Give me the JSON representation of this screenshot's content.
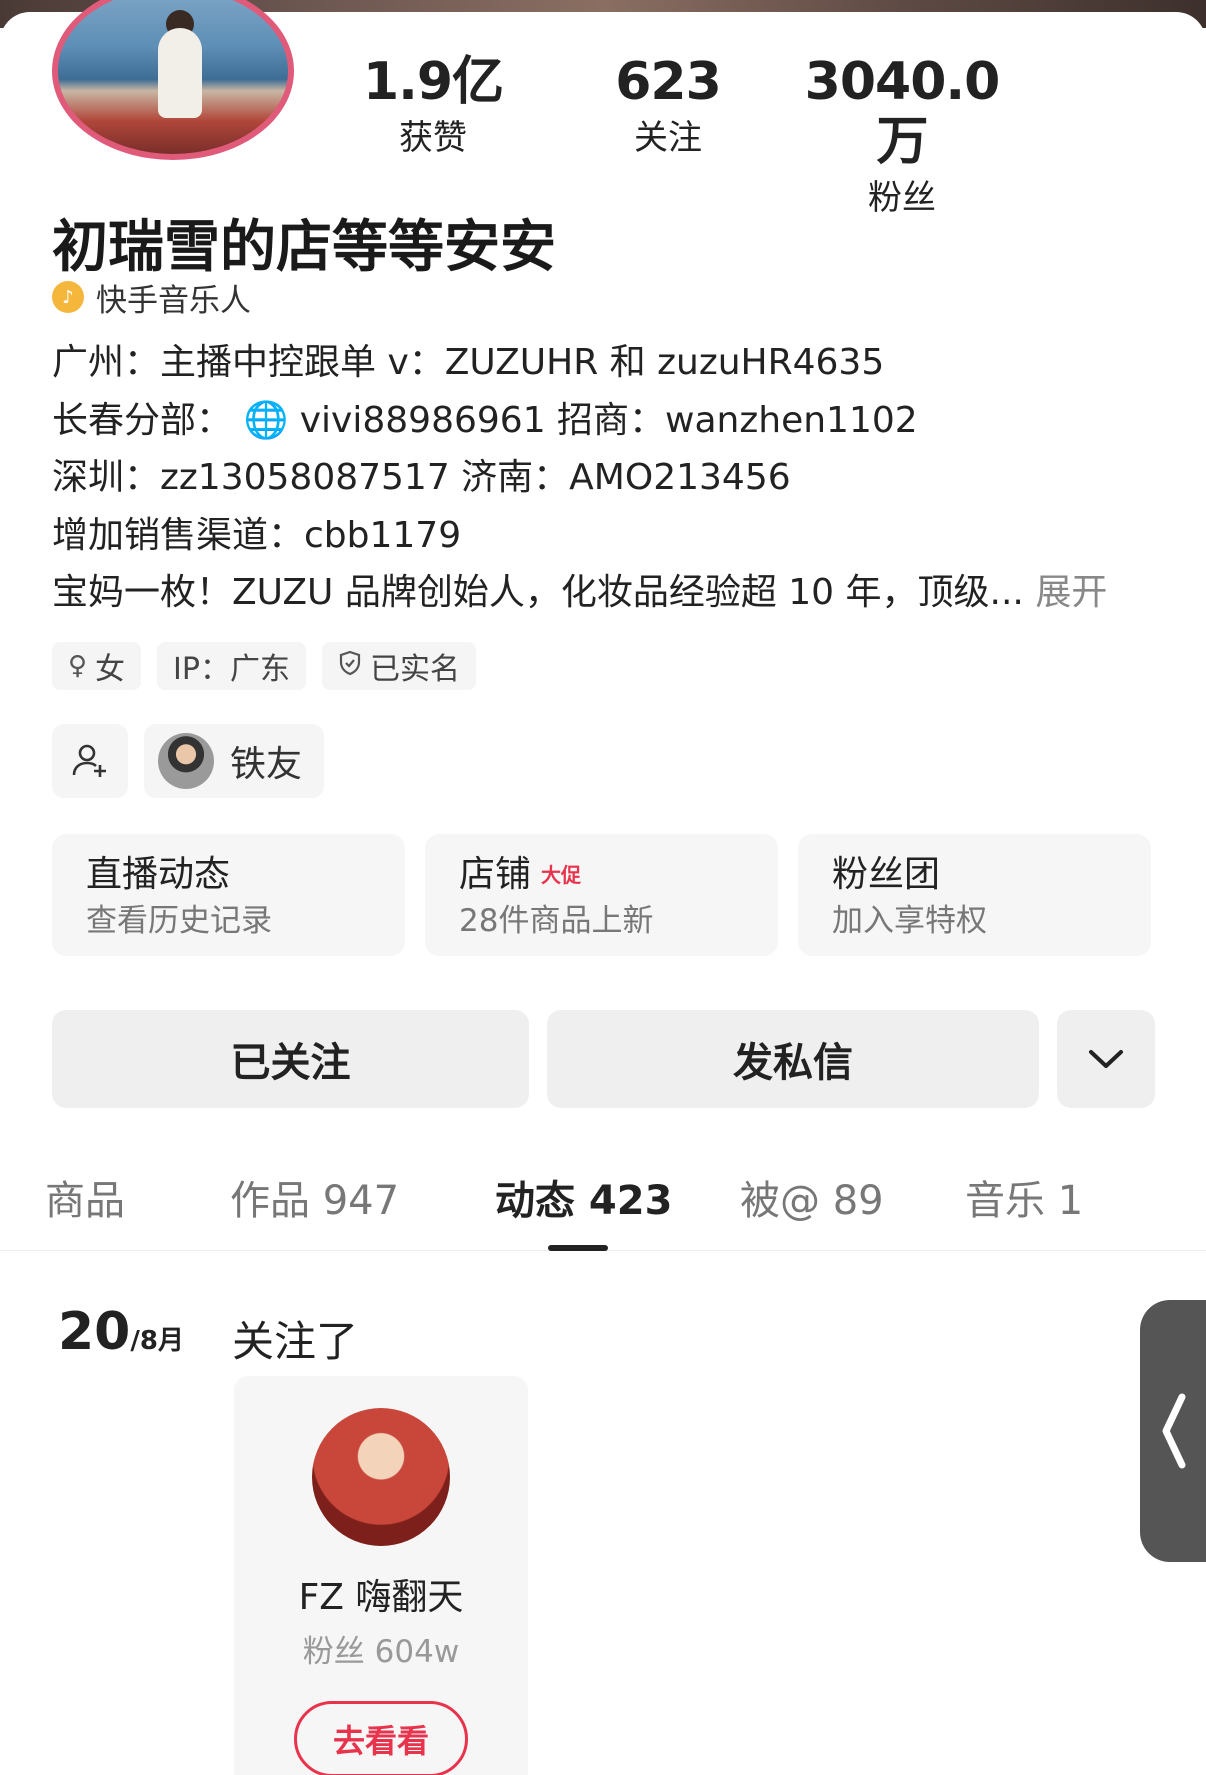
{
  "profile": {
    "name": "初瑞雪的店等等安安",
    "badge": "快手音乐人",
    "stats": [
      {
        "value": "1.9亿",
        "label": "获赞"
      },
      {
        "value": "623",
        "label": "关注"
      },
      {
        "value": "3040.0万",
        "label": "粉丝"
      }
    ],
    "bio_lines": [
      "广州：主播中控跟单 v：ZUZUHR 和 zuzuHR4635",
      "长春分部：",
      "vivi88986961  招商：wanzhen1102",
      "深圳：zz13058087517 济南：AMO213456",
      "增加销售渠道：cbb1179",
      "宝妈一枚！ZUZU 品牌创始人，化妆品经验超 10 年，顶级..."
    ],
    "expand_label": "展开",
    "tags": [
      "女",
      "IP：广东",
      "已实名"
    ],
    "friend_label": "铁友"
  },
  "cards": [
    {
      "title": "直播动态",
      "subtitle": "查看历史记录"
    },
    {
      "title": "店铺",
      "promo": "大促",
      "subtitle": "28件商品上新"
    },
    {
      "title": "粉丝团",
      "subtitle": "加入享特权"
    }
  ],
  "actions": {
    "follow": "已关注",
    "message": "发私信"
  },
  "tabs": [
    {
      "label": "商品"
    },
    {
      "label": "作品 947"
    },
    {
      "label": "动态 423"
    },
    {
      "label": "被@ 89"
    },
    {
      "label": "音乐 1"
    }
  ],
  "feed": {
    "day": "20",
    "month": "/8月",
    "action": "关注了",
    "user": {
      "name": "FZ 嗨翻天",
      "fans": "粉丝 604w",
      "button": "去看看"
    }
  },
  "colors": {
    "accent_red": "#e8334d",
    "avatar_ring": "#e05a7a",
    "badge_gold": "#f5b73b"
  }
}
